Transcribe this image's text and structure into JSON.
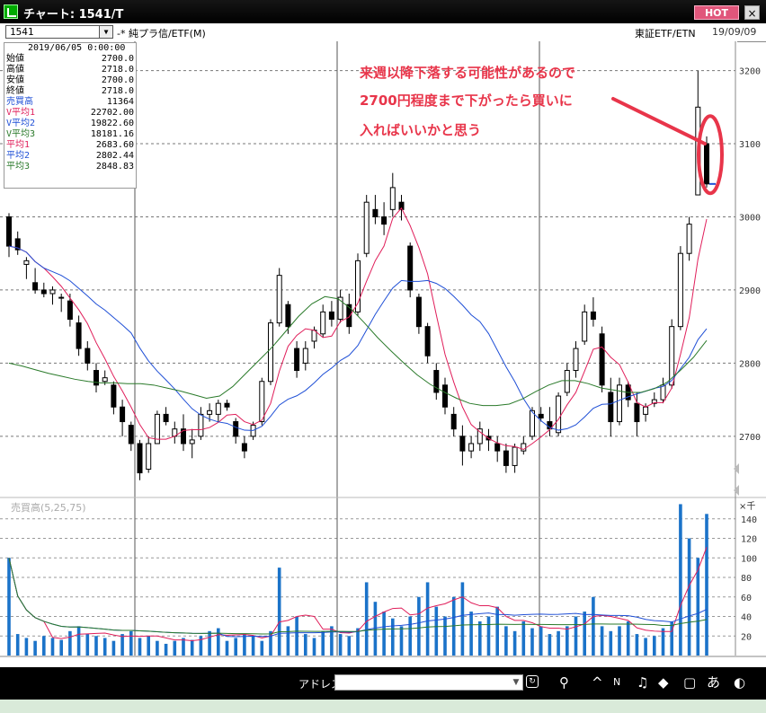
{
  "window": {
    "title": "チャート: 1541/T",
    "hot_label": "HOT",
    "close_label": "×"
  },
  "toolbar": {
    "symbol": "1541",
    "instrument_name": "-* 純プラ信/ETF(M)",
    "market": "東証ETF/ETN",
    "date": "19/09/09"
  },
  "info": {
    "date": "2019/06/05  0:00:00",
    "rows": [
      {
        "label": "始値",
        "value": "2700.0",
        "color": "#000000"
      },
      {
        "label": "高値",
        "value": "2718.0",
        "color": "#000000"
      },
      {
        "label": "安値",
        "value": "2700.0",
        "color": "#000000"
      },
      {
        "label": "終値",
        "value": "2718.0",
        "color": "#000000"
      },
      {
        "label": "売買高",
        "value": "11364",
        "color": "#1f4fd6"
      },
      {
        "label": "V平均1",
        "value": "22702.00",
        "color": "#e01e5a"
      },
      {
        "label": "V平均2",
        "value": "19822.60",
        "color": "#1f4fd6"
      },
      {
        "label": "V平均3",
        "value": "18181.16",
        "color": "#2a7a2a"
      },
      {
        "label": "平均1",
        "value": "2683.60",
        "color": "#e01e5a"
      },
      {
        "label": "平均2",
        "value": "2802.44",
        "color": "#1f4fd6"
      },
      {
        "label": "平均3",
        "value": "2848.83",
        "color": "#2a7a2a"
      }
    ]
  },
  "annotation": {
    "line1": "来週以降下落する可能性があるので",
    "line2": "2700円程度まで下がったら買いに",
    "line3": "入ればいいかと思う",
    "color": "#e8354a"
  },
  "volume_panel": {
    "label": "売買高(5,25,75)",
    "unit_label": "×千"
  },
  "chart_data": {
    "type": "candlestick",
    "price_axis": {
      "ticks": [
        2700,
        2800,
        2900,
        3000,
        3100,
        3200
      ],
      "ylim": [
        2620,
        3240
      ]
    },
    "volume_axis": {
      "ticks": [
        20,
        40,
        60,
        80,
        100,
        120,
        140
      ],
      "ylim": [
        0,
        160
      ]
    },
    "last_price": 3045,
    "colors": {
      "ma1": "#e01e5a",
      "ma2": "#1f4fd6",
      "ma3": "#2a7a2a",
      "volume": "#1b73c9",
      "candle": "#000000"
    },
    "series": [
      {
        "name": "MA",
        "values": [
          2800,
          2796,
          2791,
          2786,
          2782,
          2778,
          2775,
          2773,
          2773,
          2772,
          2772,
          2770,
          2766,
          2762,
          2757,
          2752,
          2755,
          2768,
          2786,
          2804,
          2822,
          2843,
          2864,
          2881,
          2891,
          2888,
          2874,
          2855,
          2835,
          2817,
          2800,
          2784,
          2771,
          2761,
          2752,
          2745,
          2742,
          2742,
          2744,
          2751,
          2761,
          2770,
          2776,
          2776,
          2772,
          2766,
          2763,
          2760,
          2760,
          2765,
          2774,
          2790,
          2808,
          2831
        ]
      }
    ],
    "candles": [
      [
        3000,
        3005,
        2945,
        2960
      ],
      [
        2970,
        2980,
        2948,
        2955
      ],
      [
        2935,
        2945,
        2915,
        2940
      ],
      [
        2910,
        2930,
        2895,
        2900
      ],
      [
        2900,
        2910,
        2890,
        2895
      ],
      [
        2895,
        2905,
        2880,
        2900
      ],
      [
        2890,
        2895,
        2870,
        2890
      ],
      [
        2885,
        2895,
        2850,
        2860
      ],
      [
        2855,
        2865,
        2810,
        2820
      ],
      [
        2820,
        2830,
        2790,
        2800
      ],
      [
        2790,
        2800,
        2760,
        2770
      ],
      [
        2775,
        2790,
        2770,
        2780
      ],
      [
        2770,
        2775,
        2730,
        2740
      ],
      [
        2740,
        2750,
        2700,
        2720
      ],
      [
        2715,
        2720,
        2680,
        2690
      ],
      [
        2690,
        2695,
        2640,
        2650
      ],
      [
        2655,
        2700,
        2650,
        2690
      ],
      [
        2690,
        2735,
        2690,
        2730
      ],
      [
        2730,
        2740,
        2715,
        2720
      ],
      [
        2700,
        2720,
        2690,
        2710
      ],
      [
        2710,
        2730,
        2680,
        2690
      ],
      [
        2690,
        2710,
        2670,
        2695
      ],
      [
        2700,
        2740,
        2695,
        2730
      ],
      [
        2730,
        2745,
        2720,
        2735
      ],
      [
        2730,
        2750,
        2720,
        2745
      ],
      [
        2745,
        2750,
        2735,
        2740
      ],
      [
        2720,
        2725,
        2690,
        2700
      ],
      [
        2690,
        2700,
        2670,
        2680
      ],
      [
        2700,
        2720,
        2695,
        2715
      ],
      [
        2720,
        2780,
        2715,
        2775
      ],
      [
        2775,
        2860,
        2770,
        2855
      ],
      [
        2855,
        2930,
        2850,
        2920
      ],
      [
        2880,
        2885,
        2840,
        2850
      ],
      [
        2820,
        2830,
        2780,
        2790
      ],
      [
        2800,
        2830,
        2790,
        2820
      ],
      [
        2830,
        2850,
        2820,
        2845
      ],
      [
        2840,
        2880,
        2835,
        2870
      ],
      [
        2870,
        2885,
        2850,
        2860
      ],
      [
        2860,
        2900,
        2855,
        2890
      ],
      [
        2880,
        2895,
        2840,
        2850
      ],
      [
        2870,
        2950,
        2865,
        2940
      ],
      [
        2950,
        3030,
        2945,
        3020
      ],
      [
        3010,
        3030,
        2990,
        3000
      ],
      [
        3000,
        3020,
        2975,
        2990
      ],
      [
        3010,
        3060,
        3000,
        3040
      ],
      [
        3020,
        3030,
        2995,
        3010
      ],
      [
        2960,
        2965,
        2890,
        2900
      ],
      [
        2890,
        2895,
        2840,
        2850
      ],
      [
        2850,
        2855,
        2800,
        2810
      ],
      [
        2790,
        2800,
        2750,
        2760
      ],
      [
        2770,
        2780,
        2730,
        2740
      ],
      [
        2730,
        2740,
        2700,
        2710
      ],
      [
        2700,
        2715,
        2660,
        2680
      ],
      [
        2680,
        2700,
        2670,
        2690
      ],
      [
        2690,
        2720,
        2680,
        2710
      ],
      [
        2700,
        2710,
        2680,
        2695
      ],
      [
        2690,
        2700,
        2665,
        2680
      ],
      [
        2680,
        2690,
        2650,
        2660
      ],
      [
        2660,
        2690,
        2650,
        2685
      ],
      [
        2680,
        2700,
        2675,
        2690
      ],
      [
        2700,
        2740,
        2695,
        2735
      ],
      [
        2730,
        2740,
        2720,
        2725
      ],
      [
        2720,
        2740,
        2700,
        2710
      ],
      [
        2705,
        2760,
        2700,
        2755
      ],
      [
        2760,
        2800,
        2755,
        2790
      ],
      [
        2790,
        2830,
        2780,
        2820
      ],
      [
        2830,
        2880,
        2825,
        2870
      ],
      [
        2870,
        2890,
        2850,
        2860
      ],
      [
        2840,
        2850,
        2760,
        2770
      ],
      [
        2760,
        2780,
        2700,
        2720
      ],
      [
        2720,
        2780,
        2715,
        2770
      ],
      [
        2770,
        2775,
        2740,
        2750
      ],
      [
        2745,
        2760,
        2700,
        2720
      ],
      [
        2730,
        2745,
        2720,
        2740
      ],
      [
        2745,
        2760,
        2740,
        2750
      ],
      [
        2750,
        2780,
        2745,
        2770
      ],
      [
        2770,
        2860,
        2765,
        2850
      ],
      [
        2850,
        2960,
        2845,
        2950
      ],
      [
        2950,
        3000,
        2940,
        2990
      ],
      [
        3030,
        3200,
        3030,
        3150
      ],
      [
        3100,
        3110,
        3040,
        3045
      ]
    ],
    "volumes": [
      100,
      22,
      18,
      15,
      20,
      18,
      16,
      25,
      30,
      22,
      20,
      18,
      15,
      22,
      25,
      18,
      20,
      15,
      12,
      15,
      18,
      16,
      20,
      25,
      28,
      15,
      18,
      22,
      20,
      15,
      25,
      90,
      30,
      40,
      22,
      18,
      25,
      30,
      22,
      20,
      28,
      75,
      55,
      45,
      38,
      30,
      40,
      60,
      75,
      50,
      40,
      60,
      75,
      45,
      35,
      40,
      50,
      30,
      25,
      35,
      28,
      30,
      22,
      25,
      30,
      40,
      45,
      60,
      30,
      25,
      30,
      35,
      22,
      18,
      20,
      28,
      35,
      155,
      120,
      100,
      145
    ]
  }
}
